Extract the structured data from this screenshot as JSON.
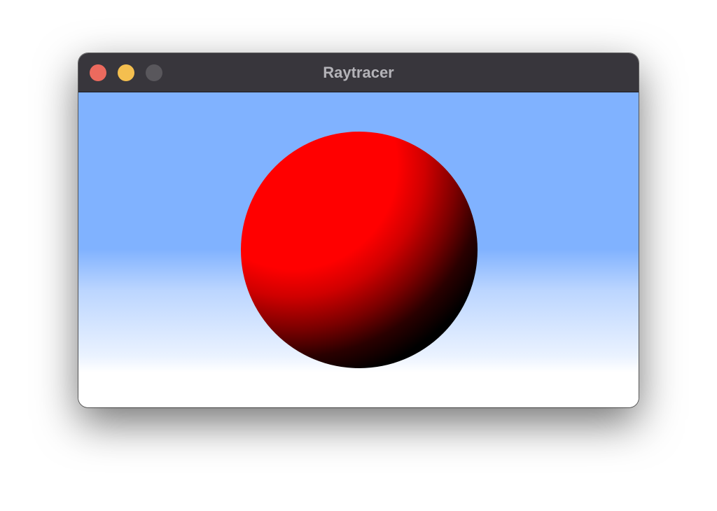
{
  "window": {
    "title": "Raytracer"
  },
  "scene": {
    "object": "sphere",
    "colors": {
      "sphere": "#ff0000",
      "sky_top": "#80b2ff",
      "sky_bottom": "#ffffff",
      "titlebar": "#38363c"
    }
  },
  "titlebar_buttons": {
    "close_color": "#ec6a5e",
    "minimize_color": "#f4bf4f",
    "zoom_color": "#59575c"
  }
}
